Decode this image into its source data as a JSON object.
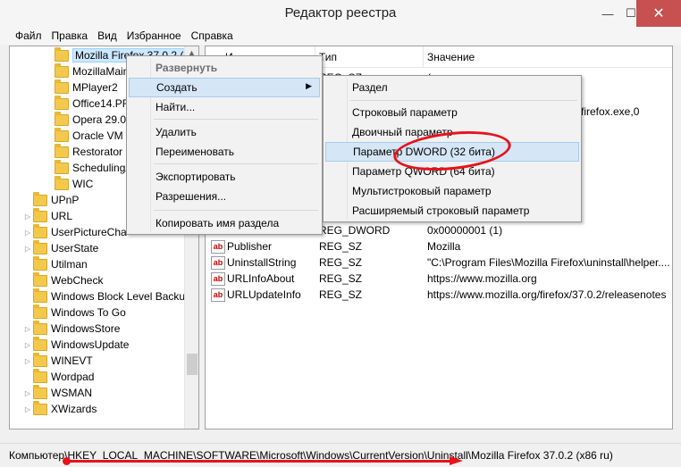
{
  "window": {
    "title": "Редактор реестра",
    "min": "—",
    "max": "☐",
    "close": "✕"
  },
  "menu": [
    "Файл",
    "Правка",
    "Вид",
    "Избранное",
    "Справка"
  ],
  "tree": [
    {
      "label": "Mozilla Firefox 37.0.2 (x8",
      "indent": 1,
      "selected": true
    },
    {
      "label": "MozillaMain",
      "indent": 1
    },
    {
      "label": "MPlayer2",
      "indent": 1
    },
    {
      "label": "Office14.PR",
      "indent": 1
    },
    {
      "label": "Opera 29.0.",
      "indent": 1
    },
    {
      "label": "Oracle VM V",
      "indent": 1
    },
    {
      "label": "Restorator 2",
      "indent": 1
    },
    {
      "label": "SchedulingA",
      "indent": 1
    },
    {
      "label": "WIC",
      "indent": 1
    },
    {
      "label": "UPnP",
      "indent": 0
    },
    {
      "label": "URL",
      "indent": 0,
      "expander": true
    },
    {
      "label": "UserPictureCha",
      "indent": 0,
      "expander": true
    },
    {
      "label": "UserState",
      "indent": 0,
      "expander": true
    },
    {
      "label": "Utilman",
      "indent": 0
    },
    {
      "label": "WebCheck",
      "indent": 0
    },
    {
      "label": "Windows Block Level Backu",
      "indent": 0
    },
    {
      "label": "Windows To Go",
      "indent": 0
    },
    {
      "label": "WindowsStore",
      "indent": 0,
      "expander": true
    },
    {
      "label": "WindowsUpdate",
      "indent": 0,
      "expander": true
    },
    {
      "label": "WINEVT",
      "indent": 0,
      "expander": true
    },
    {
      "label": "Wordpad",
      "indent": 0
    },
    {
      "label": "WSMAN",
      "indent": 0,
      "expander": true
    },
    {
      "label": "XWizards",
      "indent": 0,
      "expander": true
    }
  ],
  "columns": {
    "name": "И",
    "type": "Тип",
    "value": "Значение"
  },
  "values_partial": [
    {
      "type": "REG_SZ",
      "value": "("
    },
    {
      "value": "firefox.exe,0"
    }
  ],
  "values": [
    {
      "name": "",
      "type": "REG_DWORD",
      "value": "0x00000001 (1)"
    },
    {
      "name": "Publisher",
      "type": "REG_SZ",
      "value": "Mozilla"
    },
    {
      "name": "UninstallString",
      "type": "REG_SZ",
      "value": "\"C:\\Program Files\\Mozilla Firefox\\uninstall\\helper...."
    },
    {
      "name": "URLInfoAbout",
      "type": "REG_SZ",
      "value": "https://www.mozilla.org"
    },
    {
      "name": "URLUpdateInfo",
      "type": "REG_SZ",
      "value": "https://www.mozilla.org/firefox/37.0.2/releasenotes"
    }
  ],
  "context_menu": {
    "items": [
      {
        "label": "Развернуть",
        "bold": true
      },
      {
        "label": "Создать",
        "highlight": true,
        "submenu": "▶"
      },
      {
        "label": "Найти..."
      },
      {
        "label": "Удалить"
      },
      {
        "label": "Переименовать"
      },
      {
        "label": "Экспортировать"
      },
      {
        "label": "Разрешения..."
      },
      {
        "label": "Копировать имя раздела"
      }
    ]
  },
  "submenu": {
    "items": [
      {
        "label": "Раздел"
      },
      {
        "label": "Строковый параметр"
      },
      {
        "label": "Двоичный параметр"
      },
      {
        "label": "Параметр DWORD (32 бита)",
        "highlight": true
      },
      {
        "label": "Параметр QWORD (64 бита)"
      },
      {
        "label": "Мультистроковый параметр"
      },
      {
        "label": "Расширяемый строковый параметр"
      }
    ]
  },
  "status": {
    "path": "Компьютер\\HKEY_LOCAL_MACHINE\\SOFTWARE\\Microsoft\\Windows\\CurrentVersion\\Uninstall\\Mozilla Firefox 37.0.2 (x86 ru)"
  },
  "accent": {
    "annotation_red": "#e8121a",
    "selection": "#cce8ff"
  }
}
